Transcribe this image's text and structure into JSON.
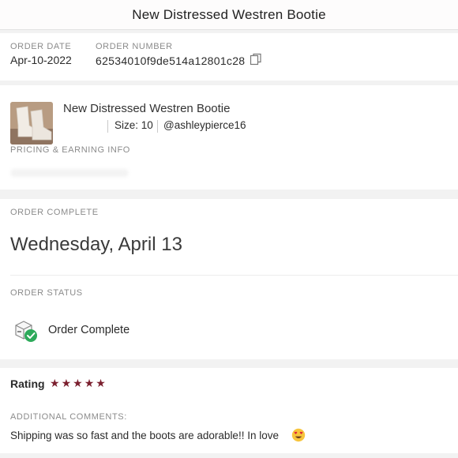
{
  "header": {
    "title": "New Distressed Westren Bootie"
  },
  "order": {
    "date_label": "ORDER DATE",
    "date_value": "Apr-10-2022",
    "number_label": "ORDER NUMBER",
    "number_value": "62534010f9de514a12801c28"
  },
  "product": {
    "title": "New Distressed Westren Bootie",
    "size": "Size: 10",
    "seller": "@ashleypierce16",
    "pricing_label": "PRICING & EARNING INFO"
  },
  "completion": {
    "label": "ORDER COMPLETE",
    "date": "Wednesday, April 13",
    "status_label": "ORDER STATUS",
    "status_text": "Order Complete"
  },
  "rating": {
    "label": "Rating",
    "stars": 5,
    "comments_label": "ADDITIONAL COMMENTS:",
    "comments_text": "Shipping was so fast and the boots are adorable!! In love"
  },
  "colors": {
    "star": "#7b1f2e",
    "check": "#2daa5a"
  },
  "icons": [
    "copy-icon",
    "order-complete-icon",
    "star-icon",
    "heart-eyes-emoji-icon"
  ]
}
